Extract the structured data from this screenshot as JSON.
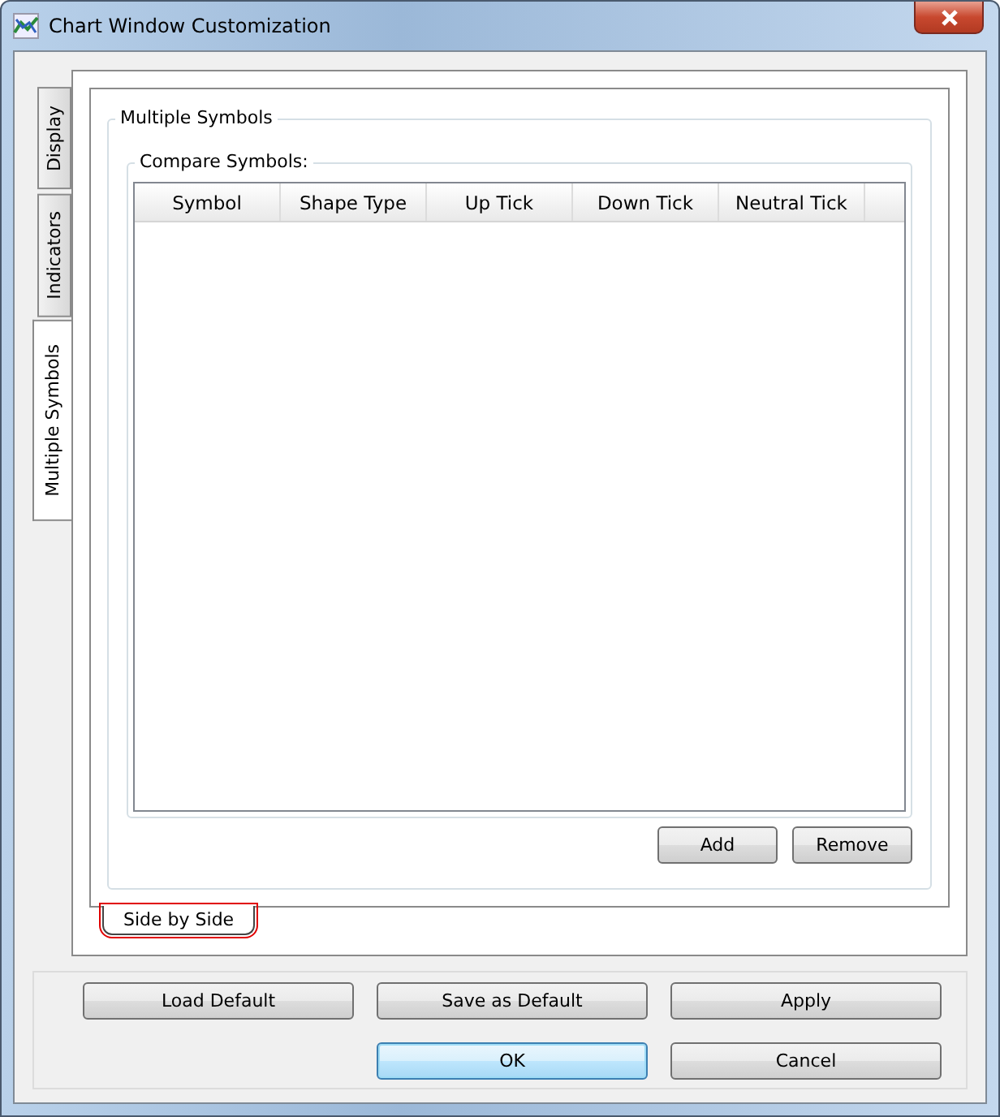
{
  "window": {
    "title": "Chart Window Customization"
  },
  "side_tabs": [
    {
      "label": "Display",
      "selected": false
    },
    {
      "label": "Indicators",
      "selected": false
    },
    {
      "label": "Multiple Symbols",
      "selected": true
    }
  ],
  "group": {
    "title": "Multiple Symbols",
    "compare": {
      "title": "Compare Symbols:",
      "columns": [
        "Symbol",
        "Shape Type",
        "Up Tick",
        "Down Tick",
        "Neutral Tick"
      ],
      "buttons": [
        "Add",
        "Remove"
      ]
    }
  },
  "bottom_tabs": [
    {
      "label": "Side by Side",
      "selected": true,
      "highlighted": true
    }
  ],
  "footer": {
    "row_1": [
      {
        "label": "Load Default",
        "default": false
      },
      {
        "label": "Save as Default",
        "default": false
      },
      {
        "label": "Apply",
        "default": false
      }
    ],
    "row_2": [
      {
        "label": "OK",
        "default": true
      },
      {
        "label": "Cancel",
        "default": false
      }
    ]
  }
}
